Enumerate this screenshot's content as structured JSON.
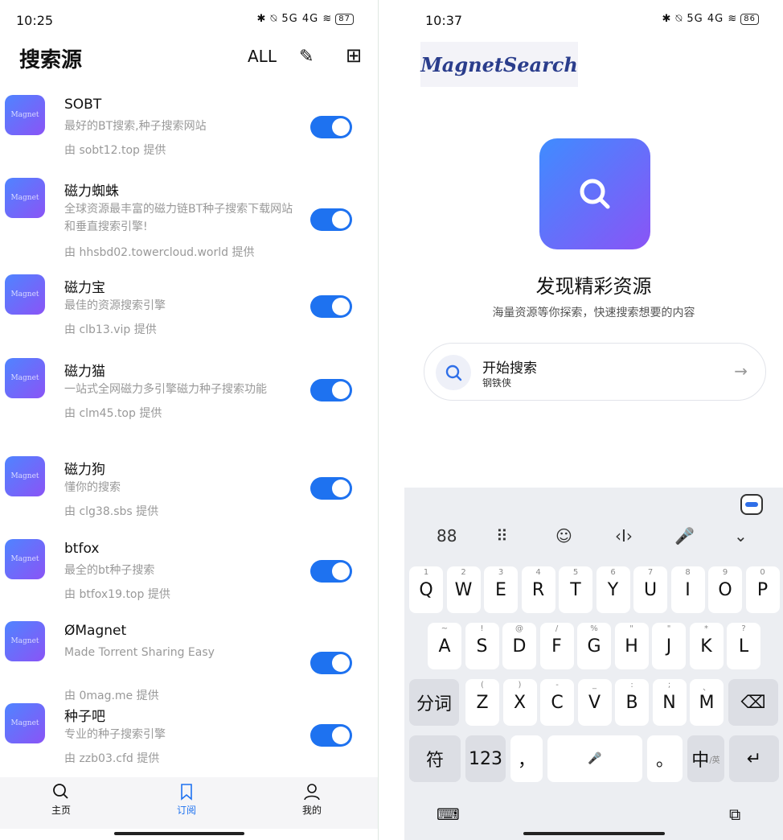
{
  "left": {
    "status": {
      "time": "10:25",
      "icons": "✱ ⍉ 5G 4G ≋",
      "battery": "87"
    },
    "title": "搜索源",
    "actions": {
      "all": "ALL",
      "edit": "✎",
      "add": "⊞"
    },
    "logo_text": "Magnet",
    "sources": [
      {
        "name": "SOBT",
        "desc": "最好的BT搜索,种子搜索网站",
        "provider": "由 sobt12.top 提供",
        "enabled": true
      },
      {
        "name": "磁力蜘蛛",
        "desc": "全球资源最丰富的磁力链BT种子搜索下载网站和垂直搜索引擎!",
        "provider": "由 hhsbd02.towercloud.world 提供",
        "enabled": true
      },
      {
        "name": "磁力宝",
        "desc": "最佳的资源搜索引擎",
        "provider": "由 clb13.vip 提供",
        "enabled": true
      },
      {
        "name": "磁力猫",
        "desc": "一站式全网磁力多引擎磁力种子搜索功能",
        "provider": "由 clm45.top 提供",
        "enabled": true
      },
      {
        "name": "磁力狗",
        "desc": "懂你的搜索",
        "provider": "由 clg38.sbs 提供",
        "enabled": true
      },
      {
        "name": "btfox",
        "desc": "最全的bt种子搜索",
        "provider": "由 btfox19.top 提供",
        "enabled": true
      },
      {
        "name": "ØMagnet",
        "desc": "Made Torrent Sharing  Easy",
        "provider": "由 0mag.me 提供",
        "enabled": true
      },
      {
        "name": "种子吧",
        "desc": "专业的种子搜索引擎",
        "provider": "由 zzb03.cfd 提供",
        "enabled": true
      }
    ],
    "nav": [
      {
        "label": "主页",
        "icon": "search-icon"
      },
      {
        "label": "订阅",
        "icon": "bookmark-icon",
        "active": true
      },
      {
        "label": "我的",
        "icon": "person-icon"
      }
    ],
    "accent": "#1e72f0"
  },
  "right": {
    "status": {
      "time": "10:37",
      "icons": "✱ ⍉ 5G 4G ≋",
      "battery": "86"
    },
    "brand": "MagnetSearch",
    "heading": "发现精彩资源",
    "subheading": "海量资源等你探索，快速搜索想要的内容",
    "search": {
      "title": "开始搜索",
      "subtitle": "钢铁侠",
      "arrow": "→"
    },
    "keyboard": {
      "toolbar": [
        "88",
        "⠿",
        "☺",
        "‹I›",
        "🎤",
        "⌄"
      ],
      "row1": [
        [
          "Q",
          "1"
        ],
        [
          "W",
          "2"
        ],
        [
          "E",
          "3"
        ],
        [
          "R",
          "4"
        ],
        [
          "T",
          "5"
        ],
        [
          "Y",
          "6"
        ],
        [
          "U",
          "7"
        ],
        [
          "I",
          "8"
        ],
        [
          "O",
          "9"
        ],
        [
          "P",
          "0"
        ]
      ],
      "row2": [
        [
          "A",
          "~"
        ],
        [
          "S",
          "!"
        ],
        [
          "D",
          "@"
        ],
        [
          "F",
          "/"
        ],
        [
          "G",
          "%"
        ],
        [
          "H",
          "\""
        ],
        [
          "J",
          "\""
        ],
        [
          "K",
          "*"
        ],
        [
          "L",
          "?"
        ]
      ],
      "row3": [
        [
          "Z",
          "("
        ],
        [
          "X",
          ")"
        ],
        [
          "C",
          "-"
        ],
        [
          "V",
          "_"
        ],
        [
          "B",
          ":"
        ],
        [
          "N",
          ";"
        ],
        [
          "M",
          "、"
        ]
      ],
      "split": "分词",
      "backspace": "⌫",
      "symbol": "符",
      "num": "123",
      "comma": "，",
      "period": "。",
      "lang": "中",
      "lang_sub": "/英",
      "enter": "↵",
      "bottom_left": "⌨",
      "bottom_right": "⧉"
    }
  }
}
